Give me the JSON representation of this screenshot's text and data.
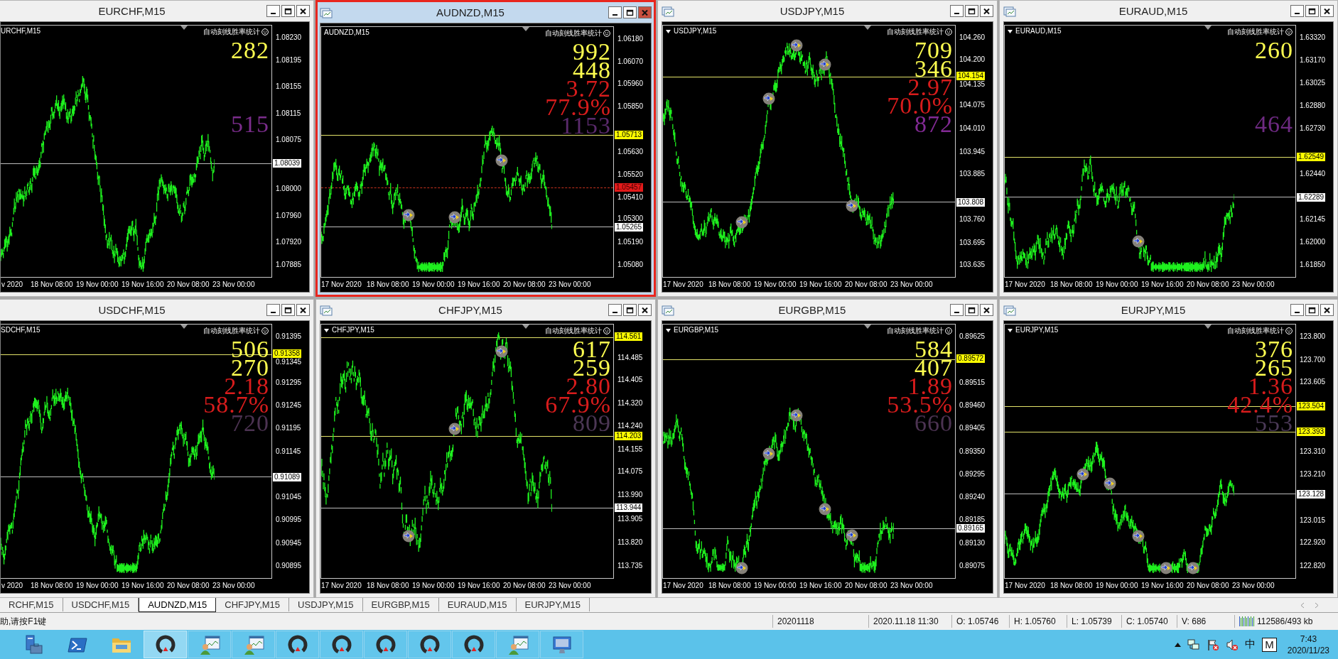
{
  "windows": [
    {
      "title": "EURCHF,M15",
      "selected": false,
      "chart_label": "URCHF,M15",
      "menu_arrow": false,
      "panel_title": "自动刻线胜率统计",
      "stats": [
        {
          "kind": "upper",
          "text": "282",
          "color": "#ffff50"
        },
        {
          "kind": "total",
          "text": "515",
          "color": "#7b2d8c"
        }
      ],
      "price_ticks": [
        "1.08230",
        "1.08195",
        "1.08155",
        "1.08115",
        "1.08075",
        "1.08000",
        "1.07960",
        "1.07920",
        "1.07885"
      ],
      "price_marks": [
        {
          "kind": "current",
          "text": "1.08039"
        }
      ],
      "time_labels": [
        "v 2020",
        "18 Nov 08:00",
        "19 Nov 00:00",
        "19 Nov 16:00",
        "20 Nov 08:00",
        "23 Nov 00:00"
      ]
    },
    {
      "title": "AUDNZD,M15",
      "selected": true,
      "chart_label": "AUDNZD,M15",
      "menu_arrow": false,
      "panel_title": "自动刻线胜率统计",
      "stats": [
        {
          "kind": "upper",
          "text": "992",
          "color": "#ffff50"
        },
        {
          "kind": "lower",
          "text": "448",
          "color": "#ffff50"
        },
        {
          "kind": "ratio",
          "text": "3.72",
          "color": "#d81c1c"
        },
        {
          "kind": "rate",
          "text": "77.9%",
          "color": "#d81c1c"
        },
        {
          "kind": "total",
          "text": "1153",
          "color": "#5a2a6c"
        }
      ],
      "price_ticks": [
        "1.06180",
        "1.06070",
        "1.05960",
        "1.05850",
        "1.05630",
        "1.05520",
        "1.05410",
        "1.05300",
        "1.05190",
        "1.05080"
      ],
      "price_marks": [
        {
          "kind": "level",
          "text": "1.05713"
        },
        {
          "kind": "alert",
          "text": "1.05457"
        },
        {
          "kind": "current",
          "text": "1.05265"
        }
      ],
      "time_labels": [
        "17 Nov 2020",
        "18 Nov 08:00",
        "19 Nov 00:00",
        "19 Nov 16:00",
        "20 Nov 08:00",
        "23 Nov 00:00"
      ],
      "trades": [
        {
          "kind": "buy"
        },
        {
          "kind": "buy"
        },
        {
          "kind": "buy"
        }
      ]
    },
    {
      "title": "USDJPY,M15",
      "selected": false,
      "chart_label": "USDJPY,M15",
      "menu_arrow": true,
      "panel_title": "自动刻线胜率统计",
      "stats": [
        {
          "kind": "upper",
          "text": "709",
          "color": "#ffff50"
        },
        {
          "kind": "lower",
          "text": "346",
          "color": "#ffff50"
        },
        {
          "kind": "ratio",
          "text": "2.97",
          "color": "#d81c1c"
        },
        {
          "kind": "rate",
          "text": "70.0%",
          "color": "#d81c1c"
        },
        {
          "kind": "total",
          "text": "872",
          "color": "#822a94"
        }
      ],
      "price_ticks": [
        "104.260",
        "104.200",
        "104.135",
        "104.075",
        "104.010",
        "103.945",
        "103.885",
        "103.760",
        "103.695",
        "103.635"
      ],
      "price_marks": [
        {
          "kind": "level",
          "text": "104.154"
        },
        {
          "kind": "current",
          "text": "103.808"
        }
      ],
      "time_labels": [
        "17 Nov 2020",
        "18 Nov 08:00",
        "19 Nov 00:00",
        "19 Nov 16:00",
        "20 Nov 08:00",
        "23 Nov 00:00"
      ],
      "trades": [
        {
          "kind": "buy"
        },
        {
          "kind": "buy"
        },
        {
          "kind": "buy"
        },
        {
          "kind": "buy"
        },
        {
          "kind": "buy"
        }
      ]
    },
    {
      "title": "EURAUD,M15",
      "selected": false,
      "chart_label": "EURAUD,M15",
      "menu_arrow": true,
      "panel_title": "自动刻线胜率统计",
      "stats": [
        {
          "kind": "upper",
          "text": "260",
          "color": "#ffff50"
        },
        {
          "kind": "total",
          "text": "464",
          "color": "#6e2a82"
        }
      ],
      "price_ticks": [
        "1.63320",
        "1.63170",
        "1.63025",
        "1.62880",
        "1.62730",
        "1.62440",
        "1.62145",
        "1.62000",
        "1.61850"
      ],
      "price_marks": [
        {
          "kind": "level",
          "text": "1.62549"
        },
        {
          "kind": "current",
          "text": "1.62289"
        }
      ],
      "time_labels": [
        "17 Nov 2020",
        "18 Nov 08:00",
        "19 Nov 00:00",
        "19 Nov 16:00",
        "20 Nov 08:00",
        "23 Nov 00:00"
      ],
      "trades": [
        {
          "kind": "buy"
        }
      ]
    },
    {
      "title": "USDCHF,M15",
      "selected": false,
      "chart_label": "SDCHF,M15",
      "menu_arrow": false,
      "panel_title": "自动刻线胜率统计",
      "stats": [
        {
          "kind": "upper",
          "text": "506",
          "color": "#ffff50"
        },
        {
          "kind": "lower",
          "text": "270",
          "color": "#ffff50"
        },
        {
          "kind": "ratio",
          "text": "2.18",
          "color": "#d81c1c"
        },
        {
          "kind": "rate",
          "text": "58.7%",
          "color": "#d81c1c"
        },
        {
          "kind": "total",
          "text": "720",
          "color": "#4c3352"
        }
      ],
      "price_ticks": [
        "0.91395",
        "0.91345",
        "0.91295",
        "0.91245",
        "0.91195",
        "0.91145",
        "0.91045",
        "0.90995",
        "0.90945",
        "0.90895"
      ],
      "price_marks": [
        {
          "kind": "level",
          "text": "0.91358"
        },
        {
          "kind": "current",
          "text": "0.91089"
        }
      ],
      "time_labels": [
        "v 2020",
        "18 Nov 08:00",
        "19 Nov 00:00",
        "19 Nov 16:00",
        "20 Nov 08:00",
        "23 Nov 00:00"
      ]
    },
    {
      "title": "CHFJPY,M15",
      "selected": false,
      "chart_label": "CHFJPY,M15",
      "menu_arrow": true,
      "panel_title": "自动刻线胜率统计",
      "stats": [
        {
          "kind": "upper",
          "text": "617",
          "color": "#ffff50"
        },
        {
          "kind": "lower",
          "text": "259",
          "color": "#ffff50"
        },
        {
          "kind": "ratio",
          "text": "2.80",
          "color": "#d81c1c"
        },
        {
          "kind": "rate",
          "text": "67.9%",
          "color": "#d81c1c"
        },
        {
          "kind": "total",
          "text": "809",
          "color": "#4c3755"
        }
      ],
      "price_ticks": [
        "114.485",
        "114.405",
        "114.320",
        "114.240",
        "114.155",
        "114.075",
        "113.990",
        "113.905",
        "113.820",
        "113.735"
      ],
      "price_marks": [
        {
          "kind": "level",
          "text": "114.561"
        },
        {
          "kind": "level",
          "text": "114.203"
        },
        {
          "kind": "current",
          "text": "113.944"
        }
      ],
      "time_labels": [
        "17 Nov 2020",
        "18 Nov 08:00",
        "19 Nov 00:00",
        "19 Nov 16:00",
        "20 Nov 08:00",
        "23 Nov 00:00"
      ],
      "trades": [
        {
          "kind": "buy"
        },
        {
          "kind": "buy"
        },
        {
          "kind": "buy"
        }
      ]
    },
    {
      "title": "EURGBP,M15",
      "selected": false,
      "chart_label": "EURGBP,M15",
      "menu_arrow": true,
      "panel_title": "自动刻线胜率统计",
      "stats": [
        {
          "kind": "upper",
          "text": "584",
          "color": "#ffff50"
        },
        {
          "kind": "lower",
          "text": "407",
          "color": "#ffff50"
        },
        {
          "kind": "ratio",
          "text": "1.89",
          "color": "#d81c1c"
        },
        {
          "kind": "rate",
          "text": "53.5%",
          "color": "#d81c1c"
        },
        {
          "kind": "total",
          "text": "660",
          "color": "#4c3352"
        }
      ],
      "price_ticks": [
        "0.89625",
        "0.89515",
        "0.89460",
        "0.89405",
        "0.89350",
        "0.89295",
        "0.89240",
        "0.89185",
        "0.89130",
        "0.89075"
      ],
      "price_marks": [
        {
          "kind": "level",
          "text": "0.89572"
        },
        {
          "kind": "current",
          "text": "0.89165"
        }
      ],
      "time_labels": [
        "17 Nov 2020",
        "18 Nov 08:00",
        "19 Nov 00:00",
        "19 Nov 16:00",
        "20 Nov 08:00",
        "23 Nov 00:00"
      ],
      "trades": [
        {
          "kind": "buy"
        },
        {
          "kind": "buy"
        },
        {
          "kind": "buy"
        },
        {
          "kind": "buy"
        },
        {
          "kind": "buy"
        }
      ]
    },
    {
      "title": "EURJPY,M15",
      "selected": false,
      "chart_label": "EURJPY,M15",
      "menu_arrow": true,
      "panel_title": "自动刻线胜率统计",
      "stats": [
        {
          "kind": "upper",
          "text": "376",
          "color": "#ffff50"
        },
        {
          "kind": "lower",
          "text": "265",
          "color": "#ffff50"
        },
        {
          "kind": "ratio",
          "text": "1.36",
          "color": "#d81c1c"
        },
        {
          "kind": "rate",
          "text": "42.4%",
          "color": "#d81c1c"
        },
        {
          "kind": "total",
          "text": "553",
          "color": "#4c3a58"
        }
      ],
      "price_ticks": [
        "123.800",
        "123.700",
        "123.605",
        "123.310",
        "123.210",
        "123.015",
        "122.920",
        "122.820"
      ],
      "price_marks": [
        {
          "kind": "level",
          "text": "123.504"
        },
        {
          "kind": "level",
          "text": "123.393"
        },
        {
          "kind": "current",
          "text": "123.128"
        }
      ],
      "time_labels": [
        "17 Nov 2020",
        "18 Nov 08:00",
        "19 Nov 00:00",
        "19 Nov 16:00",
        "20 Nov 08:00",
        "23 Nov 00:00"
      ],
      "trades": [
        {
          "kind": "buy"
        },
        {
          "kind": "buy"
        },
        {
          "kind": "buy"
        },
        {
          "kind": "buy"
        },
        {
          "kind": "buy"
        }
      ]
    }
  ],
  "tabs": [
    {
      "label": "RCHF,M15",
      "selected": false
    },
    {
      "label": "USDCHF,M15",
      "selected": false
    },
    {
      "label": "AUDNZD,M15",
      "selected": true
    },
    {
      "label": "CHFJPY,M15",
      "selected": false
    },
    {
      "label": "USDJPY,M15",
      "selected": false
    },
    {
      "label": "EURGBP,M15",
      "selected": false
    },
    {
      "label": "EURAUD,M15",
      "selected": false
    },
    {
      "label": "EURJPY,M15",
      "selected": false
    }
  ],
  "status_bar": {
    "hint": "助,请按F1键",
    "fields": [
      "20201118",
      "2020.11.18 11:30",
      "O: 1.05746",
      "H: 1.05760",
      "L: 1.05739",
      "C: 1.05740",
      "V: 686"
    ],
    "memory": "112586/493 kb"
  },
  "taskbar": {
    "items": [
      {
        "kind": "server",
        "running": false,
        "selected": false
      },
      {
        "kind": "powershell",
        "running": false,
        "selected": false
      },
      {
        "kind": "folder",
        "running": false,
        "selected": false
      },
      {
        "kind": "gauge",
        "running": true,
        "selected": true
      },
      {
        "kind": "user-chart",
        "running": true,
        "selected": false
      },
      {
        "kind": "user-chart",
        "running": true,
        "selected": false
      },
      {
        "kind": "gauge",
        "running": true,
        "selected": false
      },
      {
        "kind": "gauge",
        "running": true,
        "selected": false
      },
      {
        "kind": "gauge",
        "running": true,
        "selected": false
      },
      {
        "kind": "gauge",
        "running": true,
        "selected": false
      },
      {
        "kind": "gauge",
        "running": true,
        "selected": false
      },
      {
        "kind": "user-chart",
        "running": true,
        "selected": false
      },
      {
        "kind": "monitor",
        "running": true,
        "selected": false
      }
    ],
    "tray": {
      "ime": "中",
      "ime_mode": "M",
      "time": "7:43",
      "date": "2020/11/23"
    }
  }
}
